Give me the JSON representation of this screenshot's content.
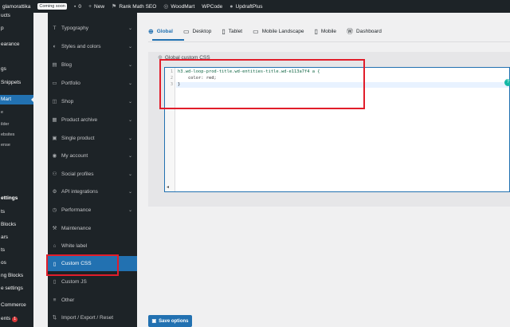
{
  "adminbar": {
    "site_name": "glamorattika",
    "coming_soon": "Coming soon",
    "comments_count": "0",
    "new_label": "New",
    "rank_math": "Rank Math SEO",
    "woodmart": "WoodMart",
    "wpcode": "WPCode",
    "updraft": "UpdraftPlus"
  },
  "wp_menu": [
    {
      "label": "ucts"
    },
    {
      "label": "p"
    },
    {
      "label": "earance"
    },
    {
      "label": "gs"
    },
    {
      "label": "Snippets"
    },
    {
      "label": "Mart"
    },
    {
      "label": "e"
    },
    {
      "label": "ilder"
    },
    {
      "label": "ebsites"
    },
    {
      "label": "ense"
    },
    {
      "label": "ettings"
    },
    {
      "label": "ts"
    },
    {
      "label": "Blocks"
    },
    {
      "label": "ars"
    },
    {
      "label": "ts"
    },
    {
      "label": "os"
    },
    {
      "label": "ng Blocks"
    },
    {
      "label": "e settings"
    },
    {
      "label": "Commerce"
    },
    {
      "label": "ents",
      "count": "1"
    }
  ],
  "settings_nav": [
    {
      "label": "Typography",
      "icon": "typography-icon",
      "glyph": "T"
    },
    {
      "label": "Styles and colors",
      "icon": "palette-icon",
      "glyph": "◐"
    },
    {
      "label": "Blog",
      "icon": "blog-icon",
      "glyph": "▤"
    },
    {
      "label": "Portfolio",
      "icon": "portfolio-icon",
      "glyph": "▭"
    },
    {
      "label": "Shop",
      "icon": "shop-icon",
      "glyph": "◫"
    },
    {
      "label": "Product archive",
      "icon": "archive-icon",
      "glyph": "▦"
    },
    {
      "label": "Single product",
      "icon": "product-icon",
      "glyph": "▣"
    },
    {
      "label": "My account",
      "icon": "account-icon",
      "glyph": "◉"
    },
    {
      "label": "Social profiles",
      "icon": "social-icon",
      "glyph": "⚇"
    },
    {
      "label": "API integrations",
      "icon": "api-icon",
      "glyph": "⚙"
    },
    {
      "label": "Performance",
      "icon": "performance-icon",
      "glyph": "◷"
    },
    {
      "label": "Maintenance",
      "icon": "maintenance-icon",
      "glyph": "⚒"
    },
    {
      "label": "White label",
      "icon": "white-label-icon",
      "glyph": "⌂"
    },
    {
      "label": "Custom CSS",
      "icon": "css-icon",
      "glyph": "▯"
    },
    {
      "label": "Custom JS",
      "icon": "js-icon",
      "glyph": "▯"
    },
    {
      "label": "Other",
      "icon": "other-icon",
      "glyph": "≡"
    },
    {
      "label": "Import / Export / Reset",
      "icon": "import-icon",
      "glyph": "⇅"
    }
  ],
  "tabs": [
    {
      "label": "Global",
      "icon": "globe-icon",
      "glyph": "⊕"
    },
    {
      "label": "Desktop",
      "icon": "desktop-icon",
      "glyph": "▭"
    },
    {
      "label": "Tablet",
      "icon": "tablet-icon",
      "glyph": "▯"
    },
    {
      "label": "Mobile Landscape",
      "icon": "mobile-landscape-icon",
      "glyph": "▭"
    },
    {
      "label": "Mobile",
      "icon": "mobile-icon",
      "glyph": "▯"
    },
    {
      "label": "Dashboard",
      "icon": "wordpress-icon",
      "glyph": "Ⓦ"
    }
  ],
  "field": {
    "title": "Global custom CSS"
  },
  "code": {
    "line1": "h3.wd-loop-prod-title.wd-entities-title.wd-e113a7f4 a {",
    "line2": "    color: red;",
    "line3": "}"
  },
  "save_label": "Save options"
}
